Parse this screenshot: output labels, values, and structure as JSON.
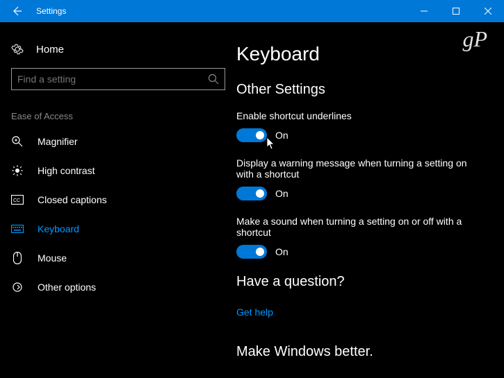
{
  "titlebar": {
    "title": "Settings"
  },
  "sidebar": {
    "home_label": "Home",
    "search_placeholder": "Find a setting",
    "group_header": "Ease of Access",
    "items": [
      {
        "label": "Magnifier"
      },
      {
        "label": "High contrast"
      },
      {
        "label": "Closed captions"
      },
      {
        "label": "Keyboard"
      },
      {
        "label": "Mouse"
      },
      {
        "label": "Other options"
      }
    ]
  },
  "main": {
    "heading": "Keyboard",
    "section_heading": "Other Settings",
    "settings": [
      {
        "label": "Enable shortcut underlines",
        "state": "On"
      },
      {
        "label": "Display a warning message when turning a setting on with a shortcut",
        "state": "On"
      },
      {
        "label": "Make a sound when turning a setting on or off with a shortcut",
        "state": "On"
      }
    ],
    "question_heading": "Have a question?",
    "help_link": "Get help",
    "feedback_heading": "Make Windows better."
  },
  "watermark": "gP"
}
